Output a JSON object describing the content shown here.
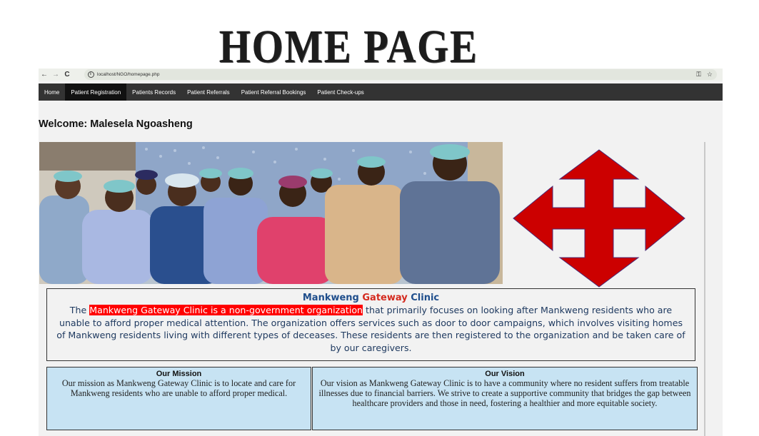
{
  "slide_title": "HOME PAGE",
  "browser": {
    "back_icon": "←",
    "forward_icon": "→",
    "reload_icon": "C",
    "info_icon": "i",
    "url": "localhost/NGO/homepage.php",
    "key_icon": "⚿",
    "star_icon": "☆"
  },
  "navbar": {
    "items": [
      {
        "label": "Home"
      },
      {
        "label": "Patient Registration"
      },
      {
        "label": "Patients Records"
      },
      {
        "label": "Patient Referrals"
      },
      {
        "label": "Patient Referral Bookings"
      },
      {
        "label": "Patient Check-ups"
      }
    ],
    "active_index": 1
  },
  "welcome": "Welcome: Malesela Ngoasheng",
  "intro": {
    "heading_part1": "Mankweng ",
    "heading_part2": "Gateway",
    "heading_part3": " Clinic",
    "body_prefix": "The ",
    "body_highlight": "Mankweng Gateway Clinic is a non-government organization",
    "body_rest": " that primarily focuses on looking after Mankweng residents who are unable to afford proper medical attention. The organization offers services such as door to door campaigns, which involves visiting homes of Mankweng residents living with different types of deceases. These residents are then registered to the organization and be taken care of by our caregivers."
  },
  "mission": {
    "title": "Our Mission",
    "text": "Our mission as Mankweng Gateway Clinic is to locate and care for Mankweng residents who are unable to afford proper medical."
  },
  "vision": {
    "title": "Our Vision",
    "text": "Our vision as Mankweng Gateway Clinic is to have a community where no resident suffers from treatable illnesses due to financial barriers. We strive to create a supportive community that bridges the gap between healthcare providers and those in need, fostering a healthier and more equitable society."
  },
  "colors": {
    "navbar": "#333333",
    "navbar_active": "#111111",
    "arrow_red": "#cc0000",
    "box_blue": "#c7e3f3",
    "highlight": "#ff0000"
  }
}
